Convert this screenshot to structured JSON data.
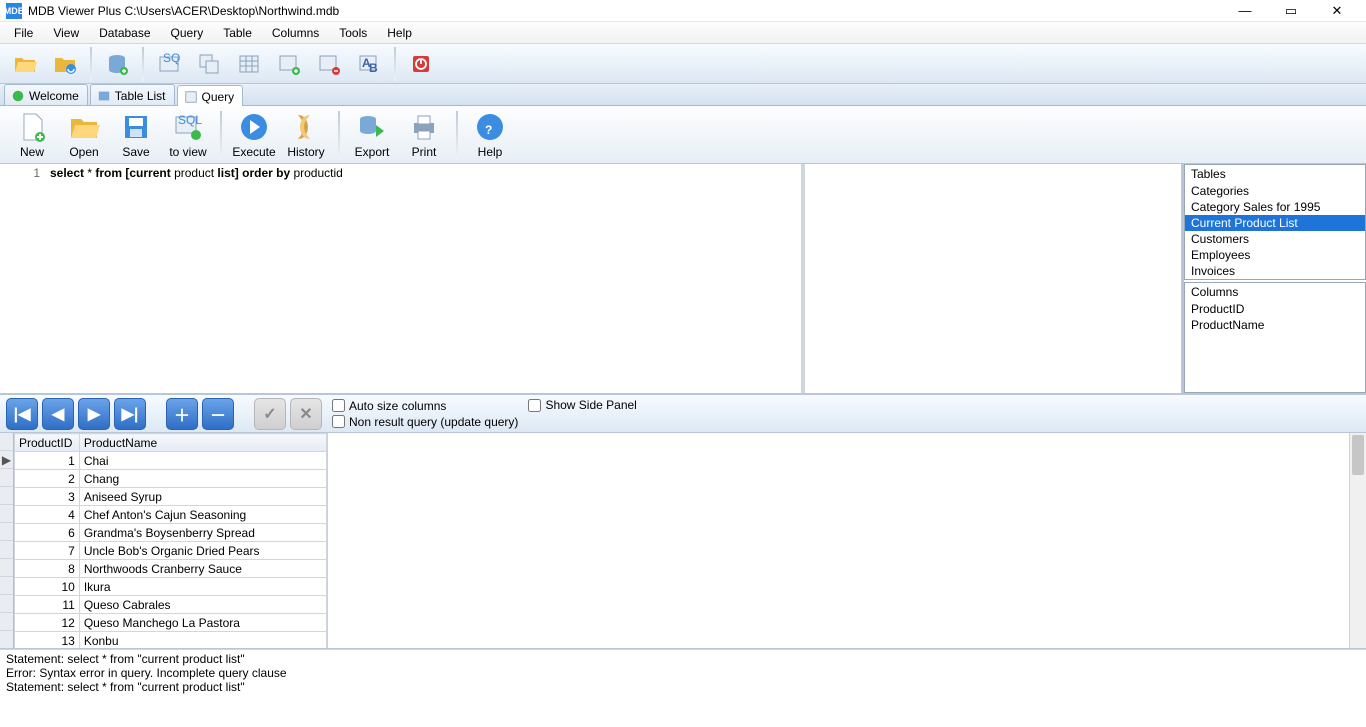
{
  "titlebar": {
    "app": "MDB",
    "title": "MDB Viewer Plus C:\\Users\\ACER\\Desktop\\Northwind.mdb"
  },
  "menu": [
    "File",
    "View",
    "Database",
    "Query",
    "Table",
    "Columns",
    "Tools",
    "Help"
  ],
  "tabs": {
    "welcome": "Welcome",
    "tablelist": "Table List",
    "query": "Query"
  },
  "queryToolbar": {
    "new": "New",
    "open": "Open",
    "save": "Save",
    "toview": "to view",
    "execute": "Execute",
    "history": "History",
    "export": "Export",
    "print": "Print",
    "help": "Help"
  },
  "editor": {
    "lineNo": "1",
    "sql_kw1": "select",
    "sql_star": " * ",
    "sql_kw2": "from",
    "sql_mid": " [current ",
    "sql_plain": "product",
    "sql_mid2": " list] ",
    "sql_kw3": "order by",
    "sql_tail": " productid"
  },
  "side": {
    "tablesHead": "Tables",
    "tables": [
      "Categories",
      "Category Sales for 1995",
      "Current Product List",
      "Customers",
      "Employees",
      "Invoices"
    ],
    "selectedTableIdx": 2,
    "columnsHead": "Columns",
    "columns": [
      "ProductID",
      "ProductName"
    ]
  },
  "nav": {
    "autoSize": "Auto size columns",
    "showSide": "Show Side Panel",
    "nonResult": "Non result query (update query)"
  },
  "grid": {
    "headers": [
      "ProductID",
      "ProductName"
    ],
    "rows": [
      [
        1,
        "Chai"
      ],
      [
        2,
        "Chang"
      ],
      [
        3,
        "Aniseed Syrup"
      ],
      [
        4,
        "Chef Anton's Cajun Seasoning"
      ],
      [
        6,
        "Grandma's Boysenberry Spread"
      ],
      [
        7,
        "Uncle Bob's Organic Dried Pears"
      ],
      [
        8,
        "Northwoods Cranberry Sauce"
      ],
      [
        10,
        "Ikura"
      ],
      [
        11,
        "Queso Cabrales"
      ],
      [
        12,
        "Queso Manchego La Pastora"
      ],
      [
        13,
        "Konbu"
      ]
    ]
  },
  "log": [
    "Statement: select * from \"current product list\"",
    "Error: Syntax error in query.  Incomplete query clause",
    "Statement: select * from \"current product list\""
  ]
}
